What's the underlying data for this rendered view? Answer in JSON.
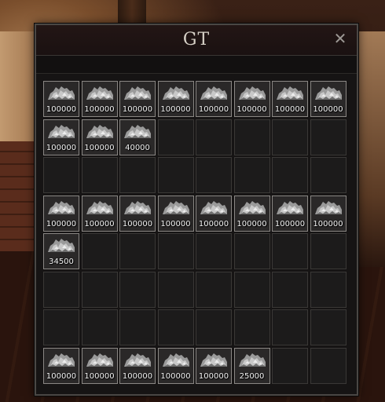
{
  "window": {
    "title": "GT"
  },
  "colors": {
    "silver_ore": "#b8b8b8",
    "slot_border": "#8a8784"
  },
  "inventory": {
    "columns": 8,
    "rows": [
      [
        {
          "item": "silver-ore",
          "qty": "100000"
        },
        {
          "item": "silver-ore",
          "qty": "100000"
        },
        {
          "item": "silver-ore",
          "qty": "100000"
        },
        {
          "item": "silver-ore",
          "qty": "100000"
        },
        {
          "item": "silver-ore",
          "qty": "100000"
        },
        {
          "item": "silver-ore",
          "qty": "100000"
        },
        {
          "item": "silver-ore",
          "qty": "100000"
        },
        {
          "item": "silver-ore",
          "qty": "100000"
        }
      ],
      [
        {
          "item": "silver-ore",
          "qty": "100000"
        },
        {
          "item": "silver-ore",
          "qty": "100000"
        },
        {
          "item": "silver-ore",
          "qty": "40000"
        },
        null,
        null,
        null,
        null,
        null
      ],
      [
        null,
        null,
        null,
        null,
        null,
        null,
        null,
        null
      ],
      [
        {
          "item": "silver-ore",
          "qty": "100000"
        },
        {
          "item": "silver-ore",
          "qty": "100000"
        },
        {
          "item": "silver-ore",
          "qty": "100000"
        },
        {
          "item": "silver-ore",
          "qty": "100000"
        },
        {
          "item": "silver-ore",
          "qty": "100000"
        },
        {
          "item": "silver-ore",
          "qty": "100000"
        },
        {
          "item": "silver-ore",
          "qty": "100000"
        },
        {
          "item": "silver-ore",
          "qty": "100000"
        }
      ],
      [
        {
          "item": "silver-ore",
          "qty": "34500"
        },
        null,
        null,
        null,
        null,
        null,
        null,
        null
      ],
      [
        null,
        null,
        null,
        null,
        null,
        null,
        null,
        null
      ],
      [
        null,
        null,
        null,
        null,
        null,
        null,
        null,
        null
      ],
      [
        {
          "item": "silver-ore",
          "qty": "100000"
        },
        {
          "item": "silver-ore",
          "qty": "100000"
        },
        {
          "item": "silver-ore",
          "qty": "100000"
        },
        {
          "item": "silver-ore",
          "qty": "100000"
        },
        {
          "item": "silver-ore",
          "qty": "100000"
        },
        {
          "item": "silver-ore",
          "qty": "25000"
        },
        null,
        null
      ]
    ]
  }
}
